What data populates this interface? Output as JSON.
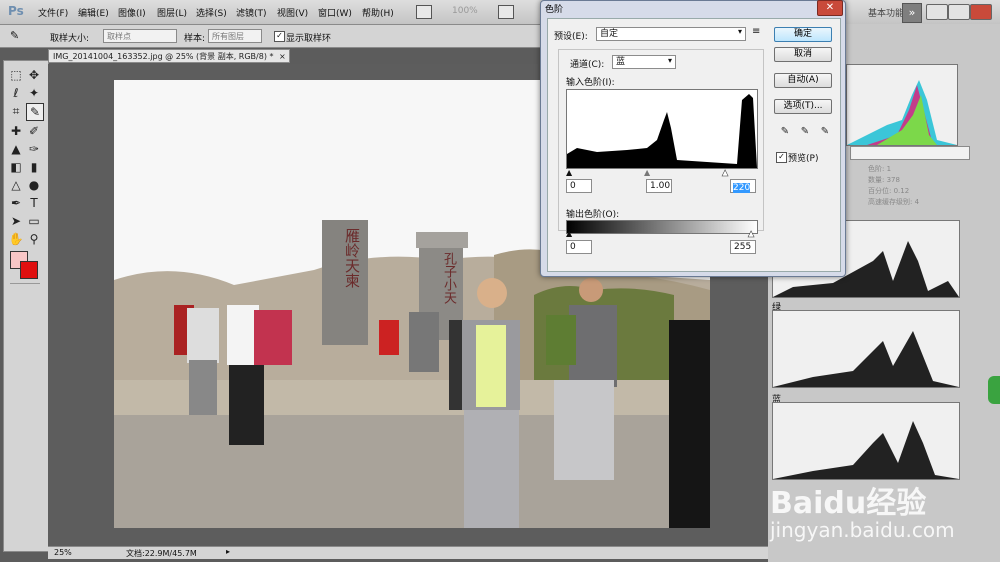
{
  "app": {
    "logo": "Ps",
    "essentials": "基本功能",
    "zoom": "100%"
  },
  "menu": [
    "文件(F)",
    "编辑(E)",
    "图像(I)",
    "图层(L)",
    "选择(S)",
    "滤镜(T)",
    "视图(V)",
    "窗口(W)",
    "帮助(H)"
  ],
  "options": {
    "sample_size_label": "取样大小:",
    "sample_size_value": "取样点",
    "sample_label": "样本:",
    "sample_value": "所有图层",
    "show_ring_label": "显示取样环"
  },
  "document": {
    "tab": "IMG_20141004_163352.jpg @ 25% (背景 副本, RGB/8) *",
    "zoom": "25%",
    "doc_size": "文档:22.9M/45.7M"
  },
  "photo_text": {
    "stone1": "雁岭天柬",
    "stone2": "孔子小天"
  },
  "dialog": {
    "title": "色阶",
    "preset_label": "预设(E):",
    "preset_value": "自定",
    "channel_label": "通道(C):",
    "channel_value": "蓝",
    "input_label": "输入色阶(I):",
    "input_black": "0",
    "input_gamma": "1.00",
    "input_white": "220",
    "output_label": "输出色阶(O):",
    "output_black": "0",
    "output_white": "255",
    "ok": "确定",
    "cancel": "取消",
    "auto": "自动(A)",
    "options": "选项(T)...",
    "preview_label": "预览(P)"
  },
  "histogram_panel": {
    "stats": [
      "色阶: 1",
      "数量: 378",
      "百分位: 0.12",
      "高速缓存级别: 4"
    ],
    "green_label": "绿",
    "blue_label": "蓝"
  },
  "watermark": {
    "line1": "Baidu经验",
    "line2": "jingyan.baidu.com"
  }
}
